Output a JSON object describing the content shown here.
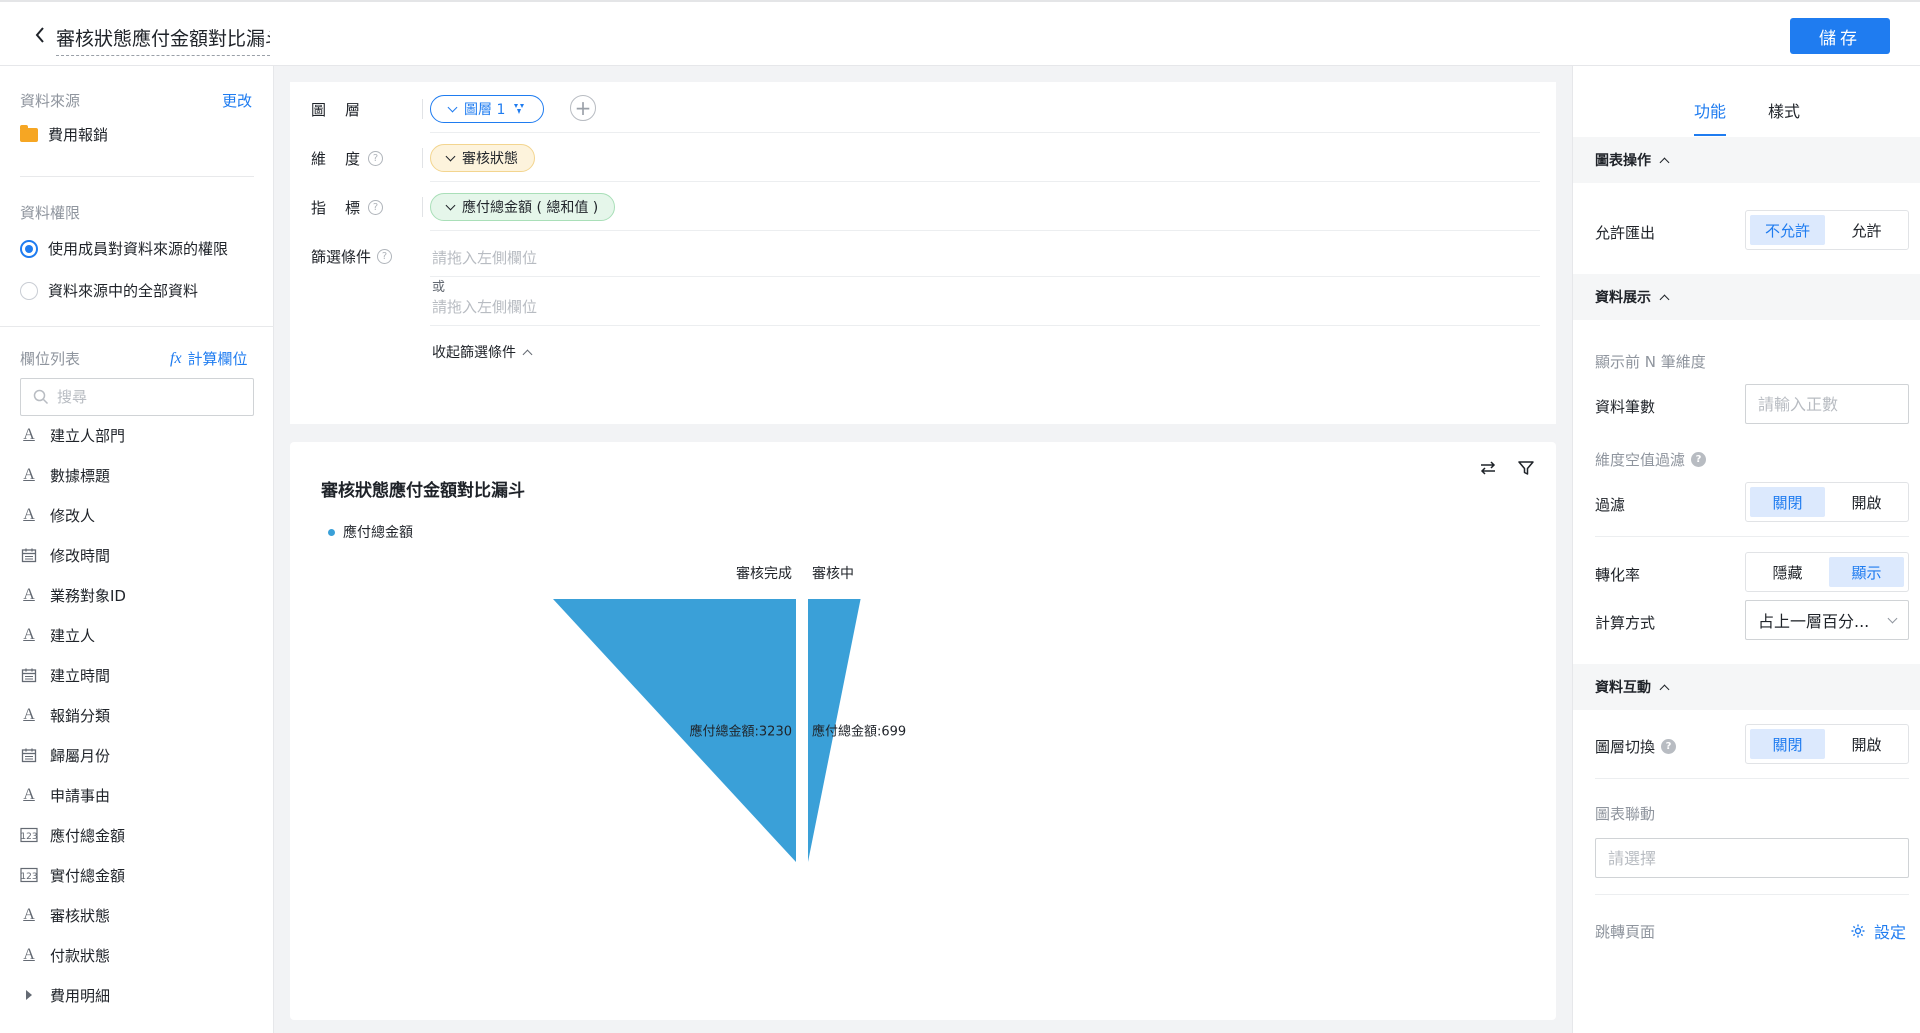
{
  "header": {
    "title": "審核狀態應付金額對比漏斗",
    "save_label": "儲存"
  },
  "left": {
    "datasource_label": "資料來源",
    "change_link": "更改",
    "datasource_name": "費用報銷",
    "permission_label": "資料權限",
    "permission_options": [
      "使用成員對資料來源的權限",
      "資料來源中的全部資料"
    ],
    "permission_selected": 0,
    "fields_label": "欄位列表",
    "calc_field_link": "計算欄位",
    "search_placeholder": "搜尋",
    "fields": [
      {
        "label": "建立人部門",
        "icon": "text-type-icon"
      },
      {
        "label": "數據標題",
        "icon": "text-type-icon"
      },
      {
        "label": "修改人",
        "icon": "text-type-icon"
      },
      {
        "label": "修改時間",
        "icon": "date-type-icon"
      },
      {
        "label": "業務對象ID",
        "icon": "text-type-icon"
      },
      {
        "label": "建立人",
        "icon": "text-type-icon"
      },
      {
        "label": "建立時間",
        "icon": "date-type-icon"
      },
      {
        "label": "報銷分類",
        "icon": "text-type-icon"
      },
      {
        "label": "歸屬月份",
        "icon": "date-type-icon"
      },
      {
        "label": "申請事由",
        "icon": "text-type-icon"
      },
      {
        "label": "應付總金額",
        "icon": "number-type-icon"
      },
      {
        "label": "實付總金額",
        "icon": "number-type-icon"
      },
      {
        "label": "審核狀態",
        "icon": "text-type-icon"
      },
      {
        "label": "付款狀態",
        "icon": "text-type-icon"
      },
      {
        "label": "費用明細",
        "icon": "expand-caret-icon"
      }
    ]
  },
  "config": {
    "layer_label": "圖　層",
    "layer_pill": "圖層 1",
    "dimension_label": "維　度",
    "dimension_pill": "審核狀態",
    "metric_label": "指　標",
    "metric_pill": "應付總金額 ( 總和值 )",
    "filter_label": "篩選條件",
    "filter_placeholder": "請拖入左側欄位",
    "or_text": "或",
    "collapse_label": "收起篩選條件"
  },
  "chart": {
    "title": "審核狀態應付金額對比漏斗",
    "legend": "應付總金額",
    "series_color": "#3aa0d8"
  },
  "chart_data": {
    "type": "funnel",
    "title": "審核狀態應付金額對比漏斗",
    "categories": [
      "審核完成",
      "審核中"
    ],
    "series": [
      {
        "name": "應付總金額",
        "values": [
          3230,
          699
        ]
      }
    ],
    "data_labels": [
      "應付總金額:3230",
      "應付總金額:699"
    ],
    "legend_position": "top-left"
  },
  "right": {
    "tabs": [
      "功能",
      "樣式"
    ],
    "active_tab": 0,
    "sections": {
      "chart_ops": "圖表操作",
      "data_display": "資料展示",
      "data_interaction": "資料互動"
    },
    "allow_export_label": "允許匯出",
    "allow_export_options": [
      "不允許",
      "允許"
    ],
    "top_n_label": "顯示前 N 筆維度",
    "record_count_label": "資料筆數",
    "record_count_placeholder": "請輸入正數",
    "null_filter_label": "維度空值過濾",
    "filter_label": "過濾",
    "filter_options": [
      "關閉",
      "開啟"
    ],
    "conversion_label": "轉化率",
    "conversion_options": [
      "隱藏",
      "顯示"
    ],
    "calc_method_label": "計算方式",
    "calc_method_value": "占上一層百分...",
    "layer_switch_label": "圖層切換",
    "layer_switch_options": [
      "關閉",
      "開啟"
    ],
    "chart_link_label": "圖表聯動",
    "chart_link_placeholder": "請選擇",
    "jump_page_label": "跳轉頁面",
    "settings_link": "設定"
  }
}
